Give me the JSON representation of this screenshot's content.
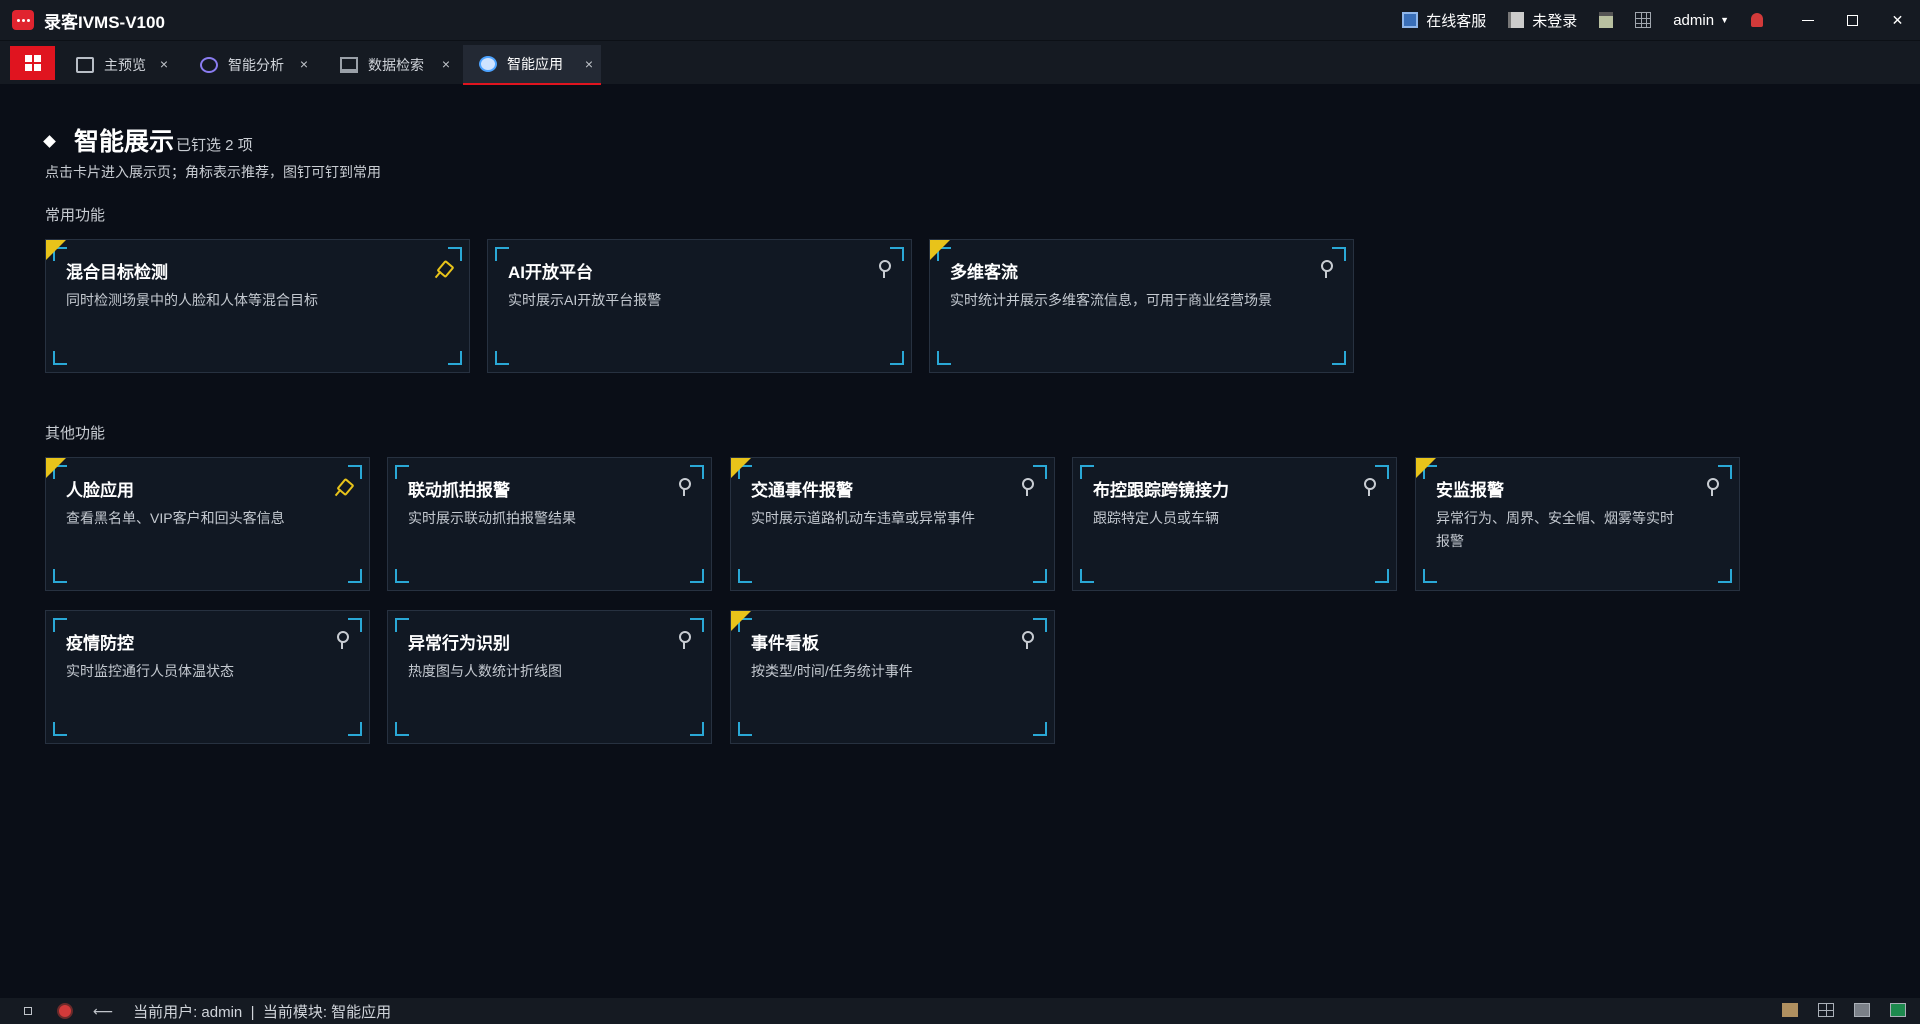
{
  "app": {
    "title": "录客IVMS-V100"
  },
  "titlebar": {
    "online_service": "在线客服",
    "login_status": "未登录",
    "user": "admin",
    "caret": "▼",
    "close": "✕"
  },
  "tabs": [
    {
      "label": "主预览",
      "icon": "preview-icon",
      "close": "×"
    },
    {
      "label": "智能分析",
      "icon": "analysis-icon",
      "close": "×"
    },
    {
      "label": "数据检索",
      "icon": "monitor-icon",
      "close": "×"
    },
    {
      "label": "智能应用",
      "icon": "app-icon",
      "close": "×",
      "active": true
    }
  ],
  "header": {
    "title": "智能展示",
    "pin_count": "已钉选 2 项",
    "hint": "点击卡片进入展示页；角标表示推荐，图钉可钉到常用"
  },
  "groups": {
    "common_label": "常用功能",
    "other_label": "其他功能"
  },
  "common_cards": [
    {
      "title": "混合目标检测",
      "desc": "同时检测场景中的人脸和人体等混合目标",
      "recommended": true,
      "pinned": true
    },
    {
      "title": "AI开放平台",
      "desc": "实时展示AI开放平台报警",
      "recommended": false,
      "pinned": false
    },
    {
      "title": "多维客流",
      "desc": "实时统计并展示多维客流信息，可用于商业经营场景",
      "recommended": true,
      "pinned": false
    }
  ],
  "other_cards": [
    {
      "title": "人脸应用",
      "desc": "查看黑名单、VIP客户和回头客信息",
      "recommended": true,
      "pinned": true
    },
    {
      "title": "联动抓拍报警",
      "desc": "实时展示联动抓拍报警结果",
      "recommended": false,
      "pinned": false
    },
    {
      "title": "交通事件报警",
      "desc": "实时展示道路机动车违章或异常事件",
      "recommended": true,
      "pinned": false
    },
    {
      "title": "布控跟踪跨镜接力",
      "desc": "跟踪特定人员或车辆",
      "recommended": false,
      "pinned": false
    },
    {
      "title": "安监报警",
      "desc_line1": "异常行为、周界、安全帽、烟雾等实时",
      "desc_line2": "报警",
      "recommended": true,
      "pinned": false
    },
    {
      "title": "疫情防控",
      "desc": "实时监控通行人员体温状态",
      "recommended": false,
      "pinned": false
    },
    {
      "title": "异常行为识别",
      "desc": "热度图与人数统计折线图",
      "recommended": false,
      "pinned": false
    },
    {
      "title": "事件看板",
      "desc": "按类型/时间/任务统计事件",
      "recommended": true,
      "pinned": false
    }
  ],
  "statusbar": {
    "back": "⟵",
    "text": "当前用户: admin  |  当前模块: 智能应用"
  },
  "colors": {
    "accent": "#e0141f",
    "recommend_flag": "#e8c31a",
    "card_corner": "#2aa8d6"
  }
}
